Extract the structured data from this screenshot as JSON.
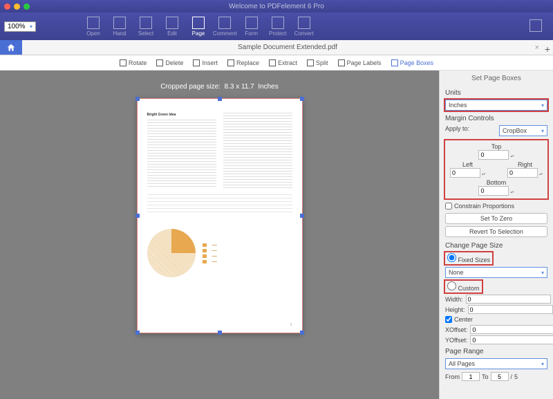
{
  "app": {
    "title": "Welcome to PDFelement 6 Pro"
  },
  "zoom": "100%",
  "tools": [
    {
      "label": "Open",
      "active": false
    },
    {
      "label": "Hand",
      "active": false
    },
    {
      "label": "Select",
      "active": false
    },
    {
      "label": "Edit",
      "active": false
    },
    {
      "label": "Page",
      "active": true
    },
    {
      "label": "Comment",
      "active": false
    },
    {
      "label": "Form",
      "active": false
    },
    {
      "label": "Protect",
      "active": false
    },
    {
      "label": "Convert",
      "active": false
    }
  ],
  "tab": {
    "doc_name": "Sample Document Extended.pdf"
  },
  "subtools": [
    {
      "label": "Rotate"
    },
    {
      "label": "Delete"
    },
    {
      "label": "Insert"
    },
    {
      "label": "Replace"
    },
    {
      "label": "Extract"
    },
    {
      "label": "Split"
    },
    {
      "label": "Page Labels"
    },
    {
      "label": "Page Boxes"
    }
  ],
  "canvas": {
    "crop_label_prefix": "Cropped page size:",
    "crop_size": "8.3 x 11.7",
    "crop_unit": "Inches",
    "page_heading": "Bright Green Idea",
    "page_number": "2"
  },
  "panel": {
    "title": "Set Page Boxes",
    "units_label": "Units",
    "units_value": "Inches",
    "margin_label": "Margin Controls",
    "apply_to_label": "Apply to:",
    "apply_to_value": "CropBox",
    "top_label": "Top",
    "left_label": "Left",
    "right_label": "Right",
    "bottom_label": "Bottom",
    "top": "0",
    "left": "0",
    "right": "0",
    "bottom": "0",
    "constrain": "Constrain Proportions",
    "set_zero": "Set To Zero",
    "revert": "Revert To Selection",
    "change_size": "Change Page Size",
    "fixed_sizes": "Fixed Sizes",
    "fixed_value": "None",
    "custom": "Custom",
    "width_label": "Width:",
    "width": "0",
    "height_label": "Height:",
    "height": "0",
    "center": "Center",
    "xoff_label": "XOffset:",
    "xoff": "0",
    "yoff_label": "YOffset:",
    "yoff": "0",
    "page_range": "Page Range",
    "range_value": "All Pages",
    "from_label": "From",
    "from": "1",
    "to_label": "To",
    "to": "5",
    "total": "5"
  }
}
